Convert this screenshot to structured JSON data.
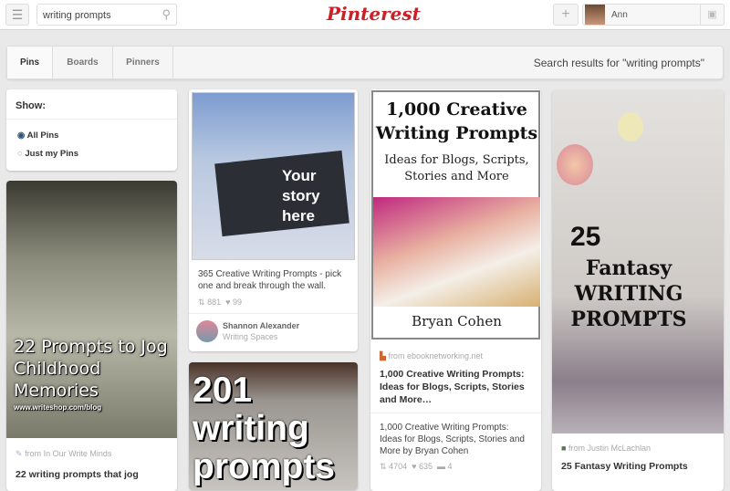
{
  "header": {
    "search_value": "writing prompts",
    "logo": "Pinterest",
    "user_name": "Ann"
  },
  "tabs": [
    {
      "label": "Pins"
    },
    {
      "label": "Boards"
    },
    {
      "label": "Pinners"
    }
  ],
  "search_results_label": "Search results for \"writing prompts\"",
  "show": {
    "label": "Show:",
    "options": [
      {
        "label": "All Pins",
        "selected": true
      },
      {
        "label": "Just my Pins",
        "selected": false
      }
    ]
  },
  "pins": [
    {
      "overlay": "22 Prompts to Jog Childhood Memories",
      "overlay_url": "www.writeshop.com/blog",
      "from": "from In Our Write Minds",
      "title": "22 writing prompts that jog"
    },
    {
      "overlay": "Your story here",
      "desc": "365 Creative Writing Prompts - pick one and break through the wall.",
      "repins": "881",
      "likes": "99",
      "pinner": "Shannon Alexander",
      "board": "Writing Spaces"
    },
    {
      "overlay": "201 writing prompts"
    },
    {
      "cover_title": "1,000 Creative Writing Prompts",
      "cover_sub": "Ideas for Blogs, Scripts, Stories and More",
      "cover_author": "Bryan Cohen",
      "from": "from ebooknetworking.net",
      "title": "1,000 Creative Writing Prompts: Ideas for Blogs, Scripts, Stories and More…",
      "desc": "1,000 Creative Writing Prompts: Ideas for Blogs, Scripts, Stories and More by Bryan Cohen",
      "repins": "4704",
      "likes": "635",
      "comments": "4"
    },
    {
      "overlay_num": "25",
      "overlay": "Fantasy WRITING PROMPTS",
      "from": "from Justin McLachlan",
      "title": "25 Fantasy Writing Prompts"
    }
  ]
}
